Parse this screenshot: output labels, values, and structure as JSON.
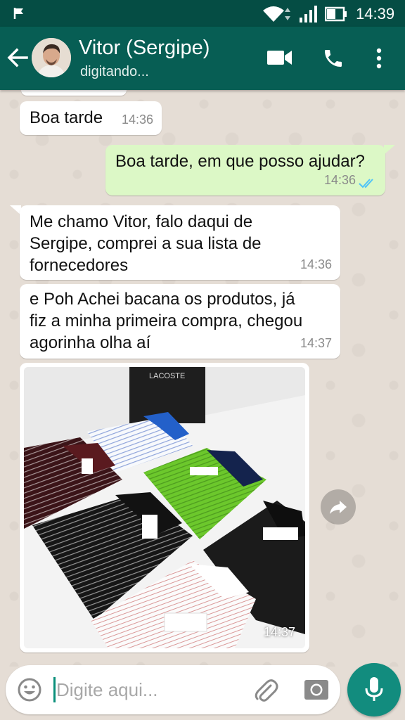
{
  "status_bar": {
    "time": "14:39"
  },
  "header": {
    "contact_name": "Vitor (Sergipe)",
    "contact_status": "digitando..."
  },
  "messages": [
    {
      "direction": "in",
      "lines": [
        "Boa tarde"
      ],
      "time": "14:36"
    },
    {
      "direction": "out",
      "lines": [
        "Boa tarde, em que posso ajudar?"
      ],
      "time": "14:36",
      "status": "read"
    },
    {
      "direction": "in",
      "lines": [
        "Me chamo Vitor, falo daqui de",
        "Sergipe, comprei a sua lista de",
        "fornecedores"
      ],
      "time": "14:36"
    },
    {
      "direction": "in",
      "lines": [
        "e Poh Achei bacana os produtos, já",
        "fiz a minha primeira compra, chegou",
        "agorinha olha aí"
      ],
      "time": "14:37"
    },
    {
      "direction": "in",
      "type": "image",
      "image_brand_text": "LACOSTE",
      "time": "14:37"
    }
  ],
  "input": {
    "placeholder": "Digite aqui..."
  },
  "colors": {
    "header": "#075e54",
    "status_bar": "#054d44",
    "outgoing_bubble": "#dcf8c6",
    "incoming_bubble": "#ffffff",
    "chat_background": "#e5ddd5",
    "read_ticks": "#4fc3f7",
    "mic_button": "#128c7e"
  },
  "icons": [
    "flag-icon",
    "wifi-icon",
    "signal-icon",
    "battery-icon",
    "back-arrow-icon",
    "video-call-icon",
    "phone-icon",
    "more-vert-icon",
    "double-check-icon",
    "forward-icon",
    "emoji-icon",
    "attach-icon",
    "camera-icon",
    "mic-icon"
  ]
}
